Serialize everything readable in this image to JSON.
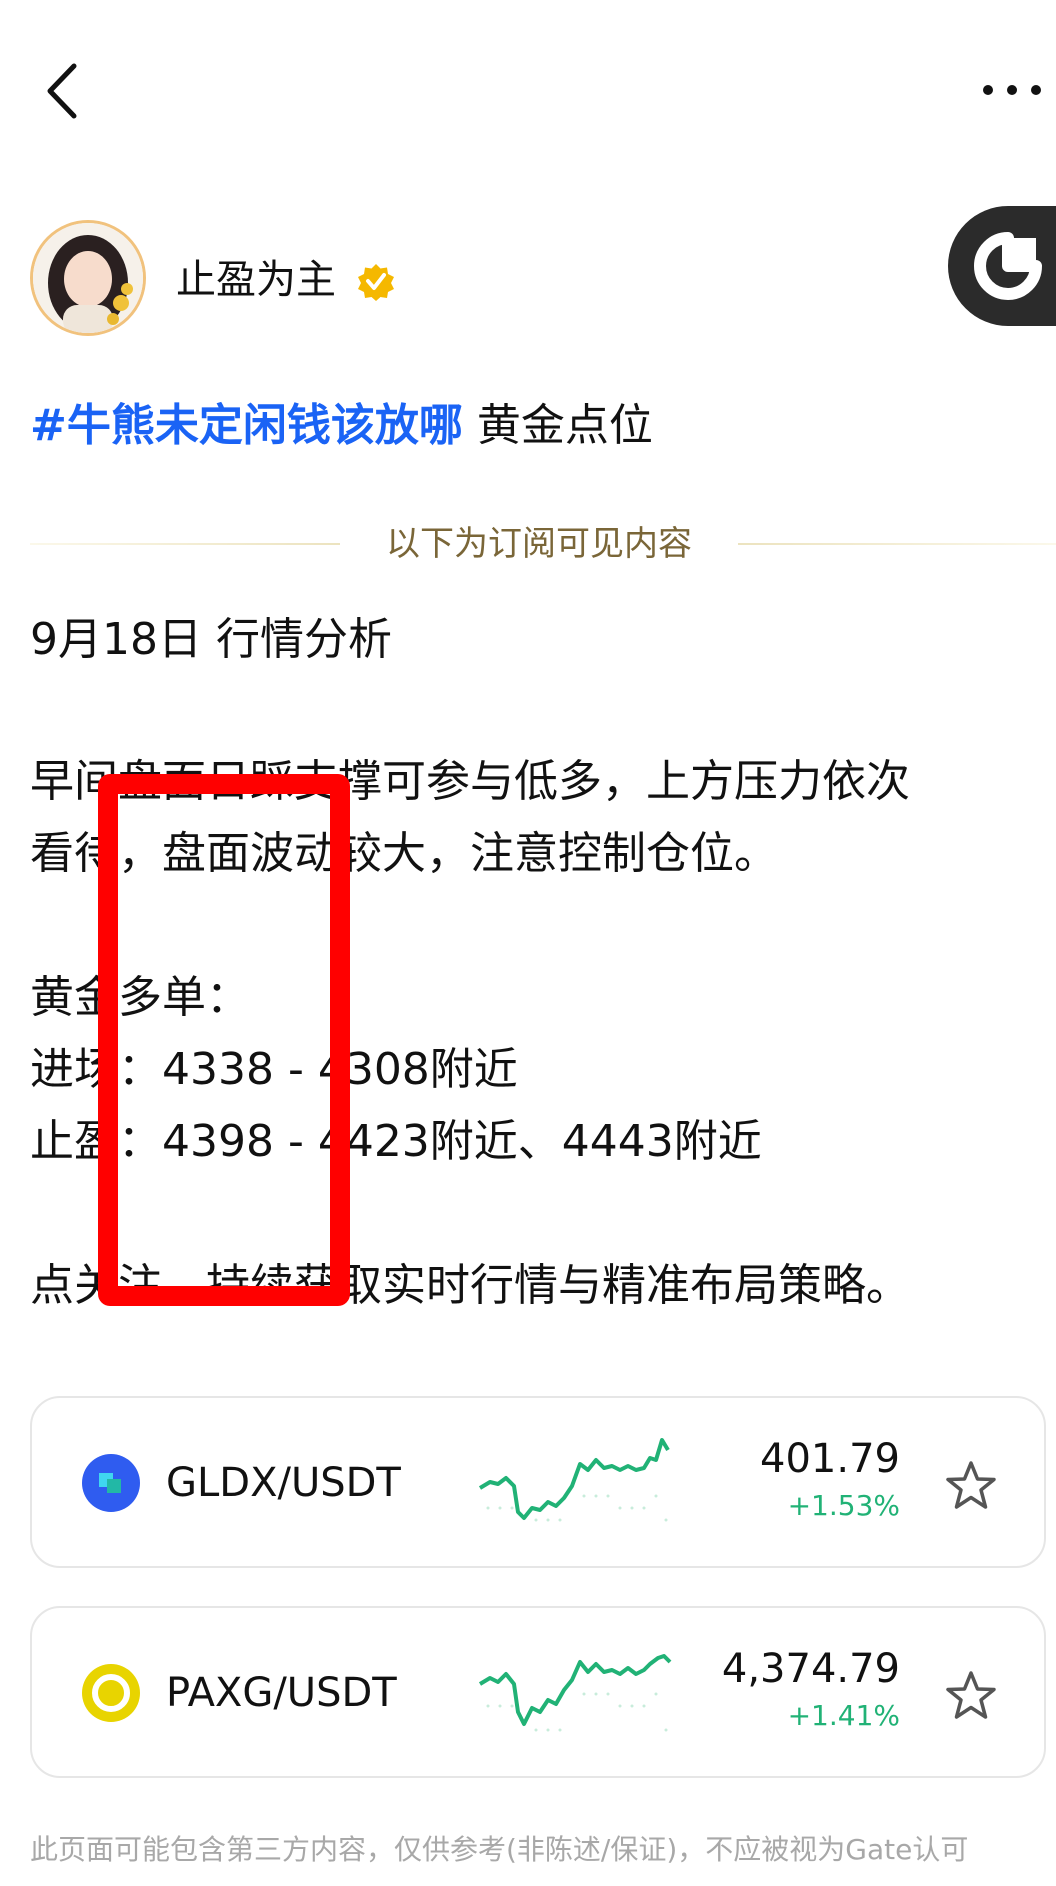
{
  "nav": {
    "back_icon": "chevron-left-icon",
    "more_icon": "more-dots-icon"
  },
  "author": {
    "name": "止盈为主",
    "verified_icon": "verified-badge-icon",
    "verified_color": "#f5b800"
  },
  "post": {
    "hashtag": "#牛熊未定闲钱该放哪",
    "title": "黄金点位",
    "subscription_label": "以下为订阅可见内容",
    "lines": {
      "date": "9月18日 行情分析",
      "p1a": "早间盘面日踩支撑可参与低多，上方压力依次",
      "p1b": "看待，盘面波动较大，注意控制仓位。",
      "p2": "黄金多单：",
      "p3": "进场：4338 - 4308附近",
      "p4": "止盈：4398 - 4423附近、4443附近",
      "p5": "点关注，持续获取实时行情与精准布局策略。"
    }
  },
  "tickers": [
    {
      "pair": "GLDX/USDT",
      "price": "401.79",
      "change": "+1.53%",
      "icon": "gldx-coin-icon",
      "icon_color": "#2f5cf0",
      "star_icon": "star-outline-icon"
    },
    {
      "pair": "PAXG/USDT",
      "price": "4,374.79",
      "change": "+1.41%",
      "icon": "paxg-coin-icon",
      "icon_color": "#e8d400",
      "star_icon": "star-outline-icon"
    }
  ],
  "disclaimer": "此页面可能包含第三方内容，仅供参考(非陈述/保证)，不应被视为Gate认可",
  "colors": {
    "hashtag": "#1a63f5",
    "positive": "#21b276",
    "annotation": "#ff0000",
    "subscription_text": "#7a6638"
  }
}
